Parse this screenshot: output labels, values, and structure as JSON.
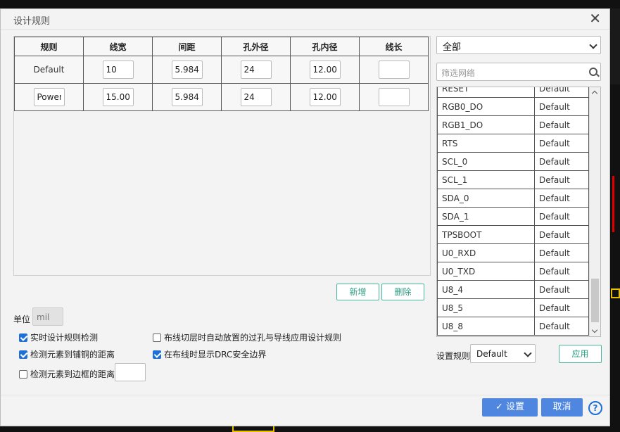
{
  "dialog": {
    "title": "设计规则"
  },
  "rules_table": {
    "headers": [
      "规则",
      "线宽",
      "间距",
      "孔外径",
      "孔内径",
      "线长"
    ],
    "rows": [
      {
        "name": "Default",
        "width": "10",
        "spacing": "5.984",
        "via_outer": "24",
        "via_inner": "12.00",
        "length": ""
      },
      {
        "name": "Power",
        "width": "15.00",
        "spacing": "5.984",
        "via_outer": "24",
        "via_inner": "12.00",
        "length": ""
      }
    ]
  },
  "buttons": {
    "add": "新增",
    "delete": "删除",
    "apply": "应用",
    "set": "设置",
    "cancel": "取消"
  },
  "unit": {
    "label": "单位",
    "value": "mil"
  },
  "options": {
    "realtime_drc": {
      "label": "实时设计规则检测",
      "checked": true
    },
    "auto_via_rule": {
      "label": "布线切层时自动放置的过孔与导线应用设计规则",
      "checked": false
    },
    "copper_distance": {
      "label": "检测元素到铺铜的距离",
      "checked": true
    },
    "drc_boundary": {
      "label": "在布线时显示DRC安全边界",
      "checked": true
    },
    "board_distance": {
      "label": "检测元素到边框的距离",
      "checked": false
    }
  },
  "net_filter": {
    "selected": "全部",
    "placeholder": "筛选网络"
  },
  "nets": [
    {
      "name": "RESET",
      "rule": "Default"
    },
    {
      "name": "RGB0_DO",
      "rule": "Default"
    },
    {
      "name": "RGB1_DO",
      "rule": "Default"
    },
    {
      "name": "RTS",
      "rule": "Default"
    },
    {
      "name": "SCL_0",
      "rule": "Default"
    },
    {
      "name": "SCL_1",
      "rule": "Default"
    },
    {
      "name": "SDA_0",
      "rule": "Default"
    },
    {
      "name": "SDA_1",
      "rule": "Default"
    },
    {
      "name": "TPSBOOT",
      "rule": "Default"
    },
    {
      "name": "U0_RXD",
      "rule": "Default"
    },
    {
      "name": "U0_TXD",
      "rule": "Default"
    },
    {
      "name": "U8_4",
      "rule": "Default"
    },
    {
      "name": "U8_5",
      "rule": "Default"
    },
    {
      "name": "U8_8",
      "rule": "Default"
    }
  ],
  "set_rule": {
    "label": "设置规则",
    "value": "Default"
  },
  "colors": {
    "accent": "#4f86e0",
    "outline": "#49b59b",
    "check": "#1e6fd6"
  }
}
